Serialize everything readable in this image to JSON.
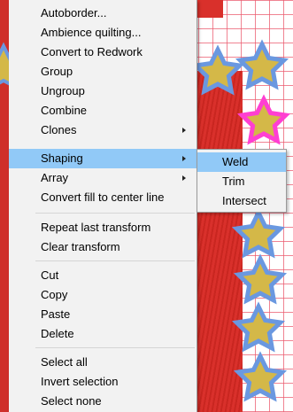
{
  "colors": {
    "menu_background": "#f2f2f2",
    "highlight": "#91c9f7",
    "grid_line": "#eb5a6e",
    "embroidery_fill": "#d9302b",
    "star_fill": "#d4b848",
    "star_outline": "#6a98e0",
    "star_highlight_outline": "#ff3fd2"
  },
  "context_menu": {
    "items": [
      {
        "label": "Autoborder...",
        "has_submenu": false
      },
      {
        "label": "Ambience quilting...",
        "has_submenu": false
      },
      {
        "label": "Convert to Redwork",
        "has_submenu": false
      },
      {
        "label": "Group",
        "has_submenu": false
      },
      {
        "label": "Ungroup",
        "has_submenu": false
      },
      {
        "label": "Combine",
        "has_submenu": false
      },
      {
        "label": "Clones",
        "has_submenu": true
      },
      {
        "label": "Shaping",
        "has_submenu": true,
        "highlighted": true
      },
      {
        "label": "Array",
        "has_submenu": true
      },
      {
        "label": "Convert fill to center line",
        "has_submenu": false
      },
      {
        "label": "Repeat last transform",
        "has_submenu": false
      },
      {
        "label": "Clear transform",
        "has_submenu": false
      },
      {
        "label": "Cut",
        "has_submenu": false
      },
      {
        "label": "Copy",
        "has_submenu": false
      },
      {
        "label": "Paste",
        "has_submenu": false
      },
      {
        "label": "Delete",
        "has_submenu": false
      },
      {
        "label": "Select all",
        "has_submenu": false
      },
      {
        "label": "Invert selection",
        "has_submenu": false
      },
      {
        "label": "Select none",
        "has_submenu": false
      }
    ]
  },
  "shaping_submenu": {
    "items": [
      {
        "label": "Weld",
        "highlighted": true
      },
      {
        "label": "Trim"
      },
      {
        "label": "Intersect"
      }
    ]
  },
  "icons": {
    "submenu_arrow": "chevron-right-icon",
    "canvas_shape": "star-icon"
  }
}
